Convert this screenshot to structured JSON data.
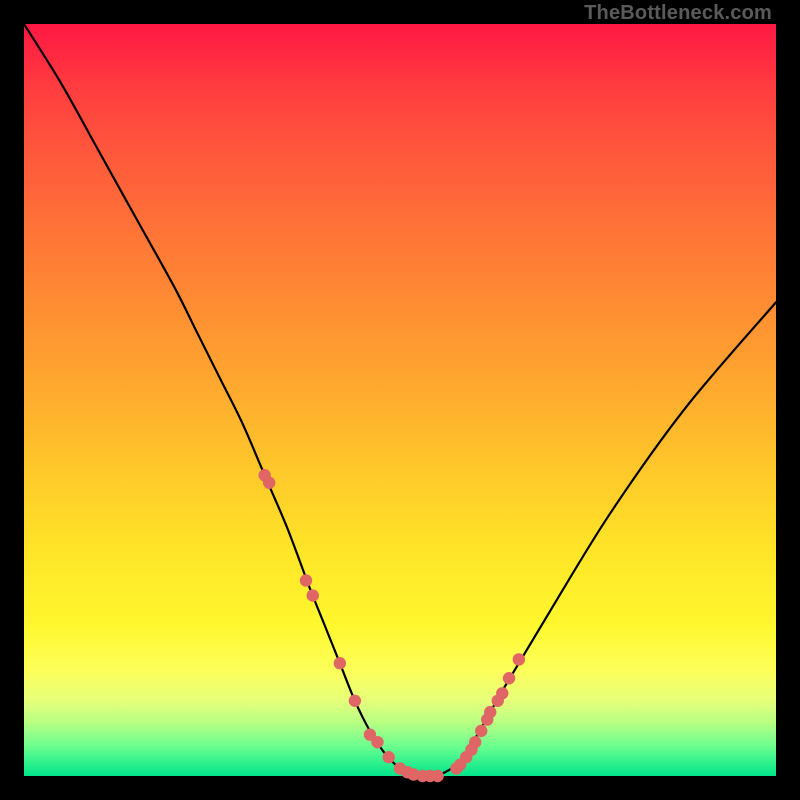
{
  "watermark": "TheBottleneck.com",
  "chart_data": {
    "type": "line",
    "title": "",
    "xlabel": "",
    "ylabel": "",
    "xlim": [
      0,
      100
    ],
    "ylim": [
      0,
      100
    ],
    "series": [
      {
        "name": "bottleneck-curve",
        "x": [
          0,
          5,
          10,
          15,
          20,
          23,
          26,
          29,
          32,
          35,
          38,
          40,
          42,
          44,
          46,
          48,
          50,
          52,
          54,
          56,
          58,
          60,
          64,
          70,
          78,
          88,
          100
        ],
        "y": [
          100,
          92,
          83,
          74,
          65,
          59,
          53,
          47,
          40,
          33,
          25,
          20,
          15,
          10,
          6,
          3,
          1,
          0,
          0,
          0.5,
          2,
          5,
          12,
          22,
          35,
          49,
          63
        ]
      }
    ],
    "markers": {
      "name": "highlight-dots",
      "color": "#e06666",
      "x": [
        32.0,
        32.6,
        37.5,
        38.4,
        42.0,
        44.0,
        46.0,
        47.0,
        48.5,
        50.0,
        51.0,
        51.8,
        53.0,
        54.0,
        55.0,
        57.5,
        58.0,
        58.8,
        59.5,
        60.0,
        60.8,
        61.6,
        62.0,
        63.0,
        63.6,
        64.5,
        65.8
      ],
      "y": [
        40.0,
        39.0,
        26.0,
        24.0,
        15.0,
        10.0,
        5.5,
        4.5,
        2.5,
        1.0,
        0.5,
        0.2,
        0.0,
        0.0,
        0.0,
        1.0,
        1.5,
        2.5,
        3.5,
        4.5,
        6.0,
        7.5,
        8.5,
        10.0,
        11.0,
        13.0,
        15.5
      ]
    }
  }
}
